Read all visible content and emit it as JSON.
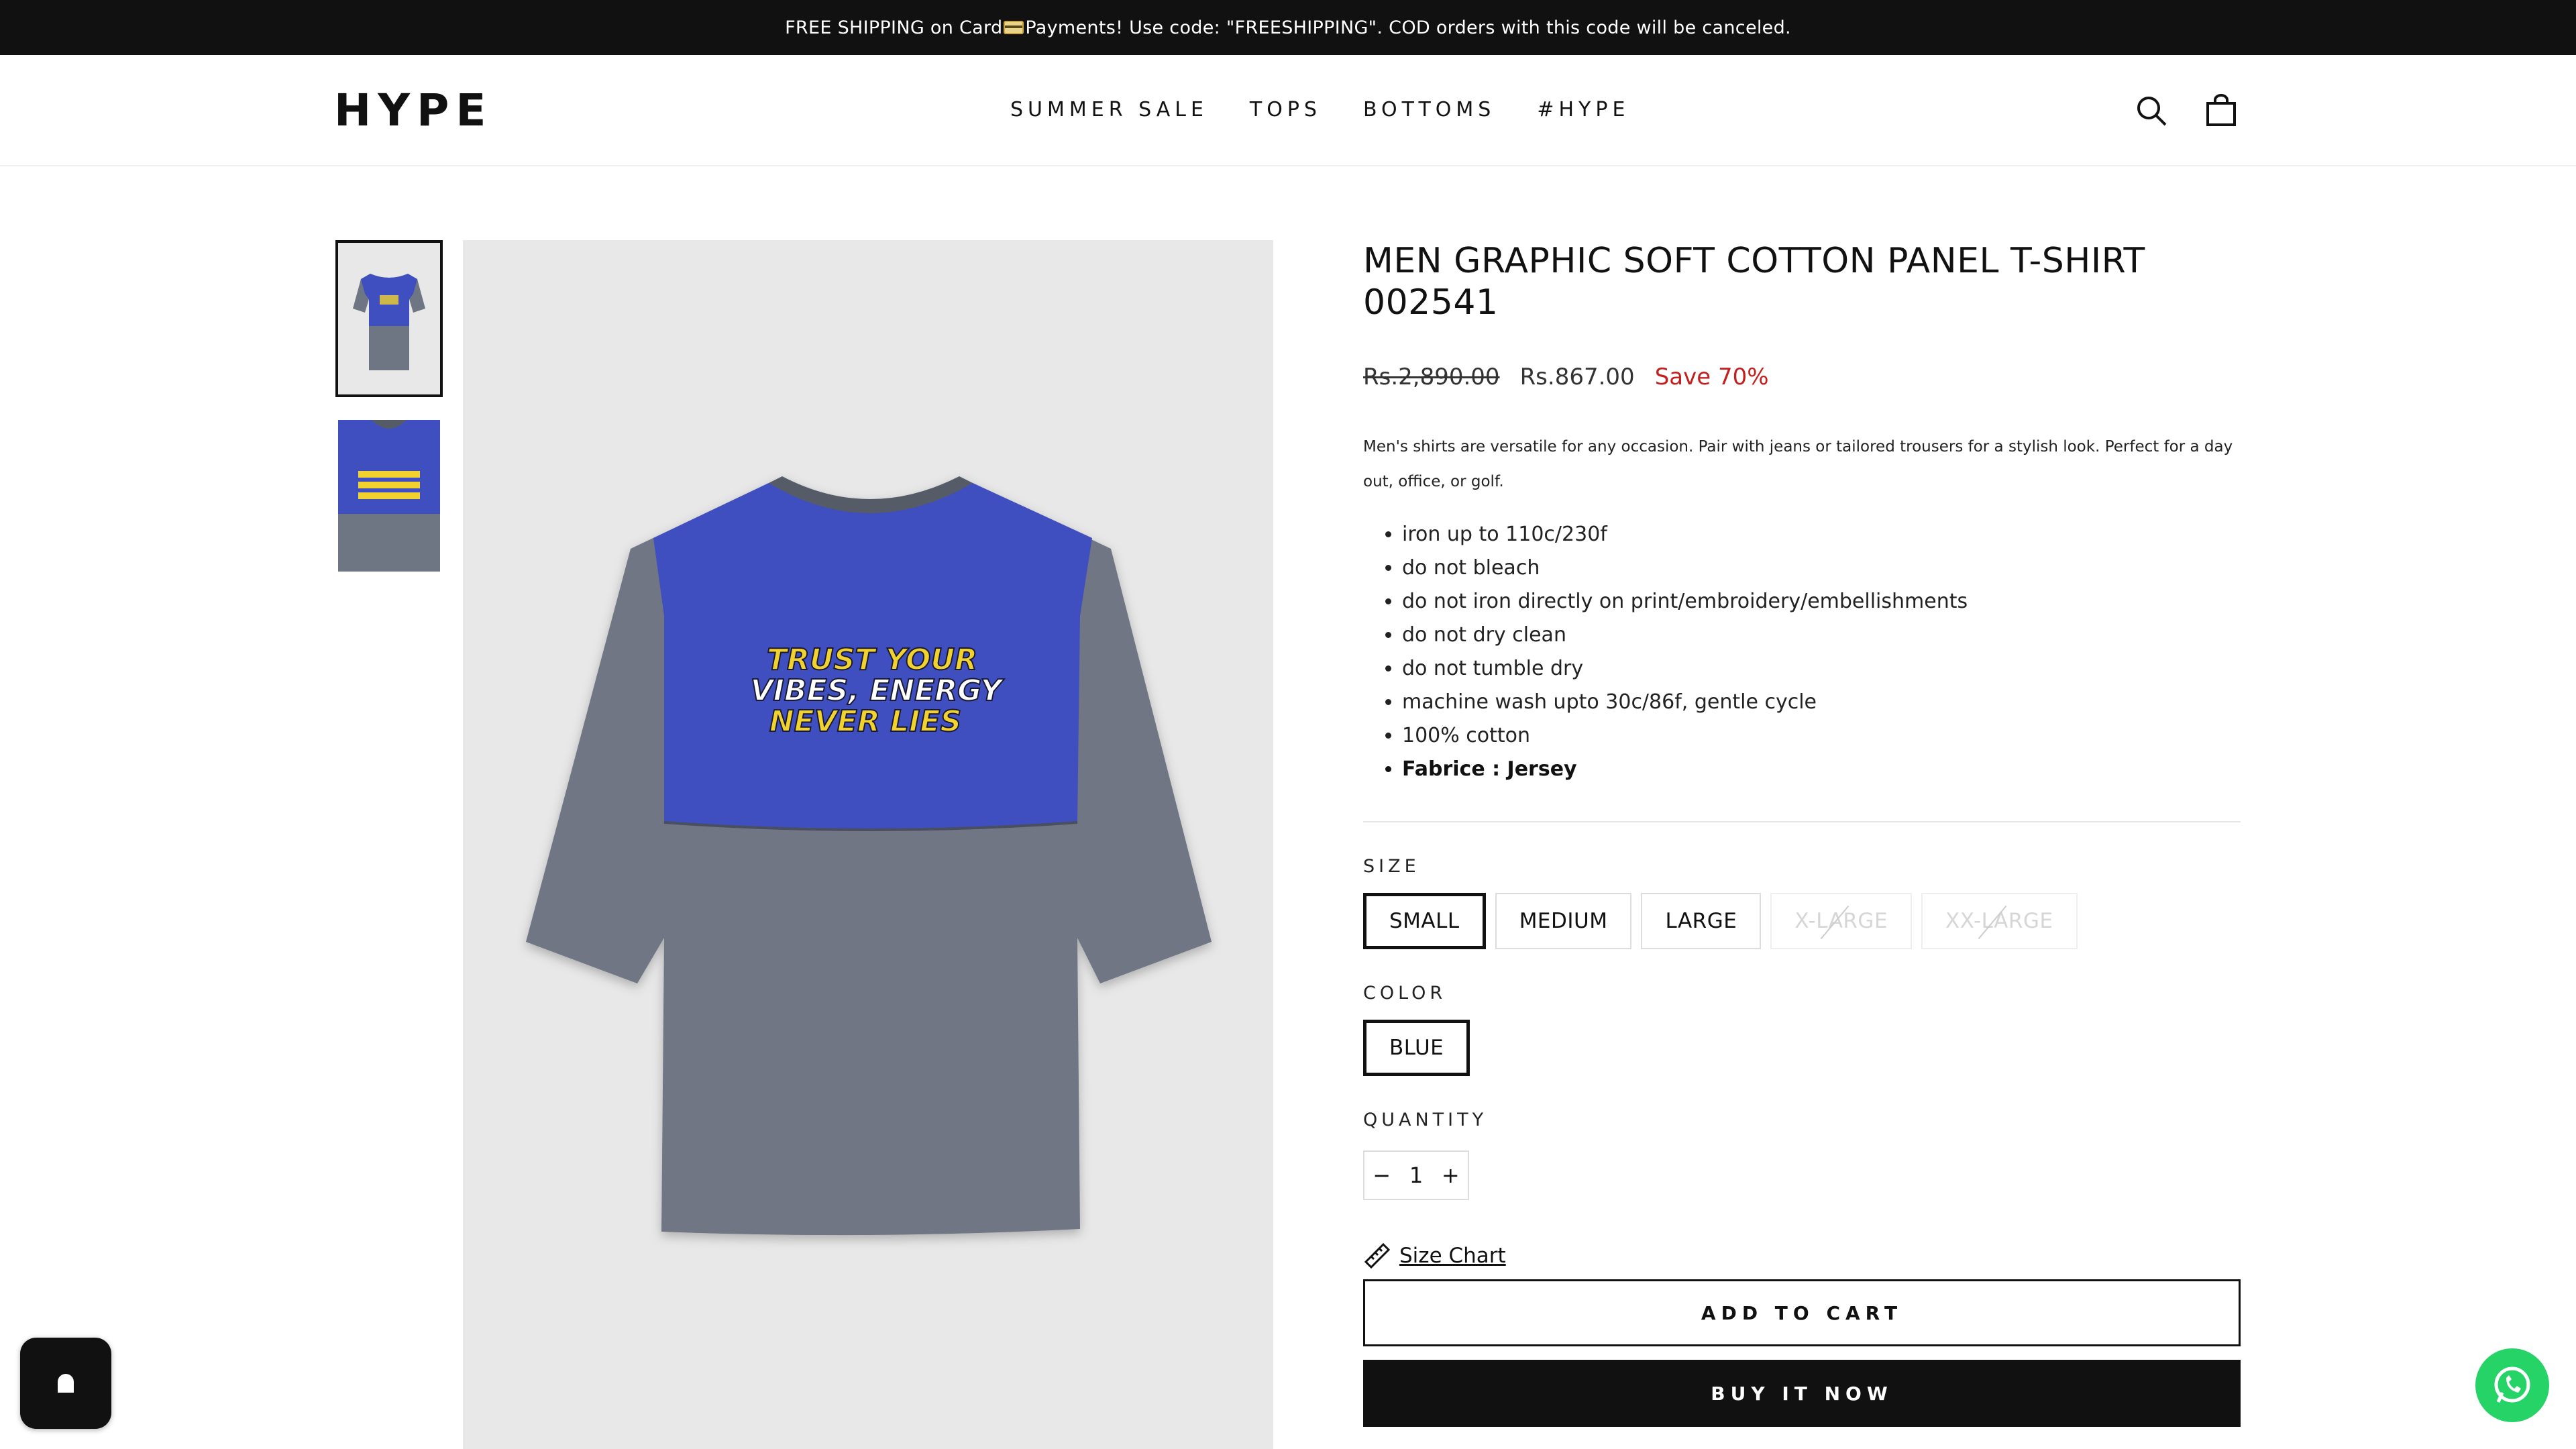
{
  "announcement": {
    "text_before": "FREE SHIPPING on Card",
    "text_after": " Payments! Use code: \"FREESHIPPING\". COD orders with this code will be canceled.",
    "icon": "credit-card-emoji"
  },
  "header": {
    "logo": "HYPE",
    "nav": [
      "SUMMER SALE",
      "TOPS",
      "BOTTOMS",
      "#HYPE"
    ],
    "icons": [
      "search-icon",
      "bag-icon"
    ]
  },
  "gallery": {
    "thumbnails": [
      "thumb-front",
      "thumb-detail"
    ],
    "print_lines": [
      "TRUST YOUR",
      "VIBES, ENERGY",
      "NEVER LIES"
    ],
    "colors": {
      "blue": "#3f4fbf",
      "grey": "#6f7683",
      "bg": "#e8e8e8",
      "yellow": "#f2d22e"
    }
  },
  "product": {
    "title": "MEN GRAPHIC SOFT COTTON PANEL T-SHIRT 002541",
    "price_old": "Rs.2,890.00",
    "price_new": "Rs.867.00",
    "save": "Save 70%",
    "description": "Men's shirts are versatile for any occasion. Pair with jeans or tailored trousers for a stylish look. Perfect for a day out, office, or golf.",
    "care": [
      "iron up to 110c/230f",
      "do not bleach",
      "do not iron directly on print/embroidery/embellishments",
      "do not dry clean",
      "do not tumble dry",
      "machine wash upto 30c/86f, gentle cycle",
      "100% cotton",
      "Fabrice : Jersey"
    ],
    "size_label": "SIZE",
    "sizes": [
      "SMALL",
      "MEDIUM",
      "LARGE",
      "X-LARGE",
      "XX-LARGE"
    ],
    "selected_size": "SMALL",
    "unavailable_sizes": [
      "X-LARGE",
      "XX-LARGE"
    ],
    "color_label": "COLOR",
    "colors": [
      "BLUE"
    ],
    "quantity_label": "QUANTITY",
    "quantity": "1",
    "qty_minus": "−",
    "qty_plus": "+",
    "size_chart": "Size Chart",
    "add_to_cart": "ADD TO CART",
    "buy_now": "BUY IT NOW"
  },
  "widgets": {
    "chat_icon": "chat-bubble-icon",
    "whatsapp_icon": "whatsapp-icon",
    "whatsapp_color": "#25d366"
  }
}
